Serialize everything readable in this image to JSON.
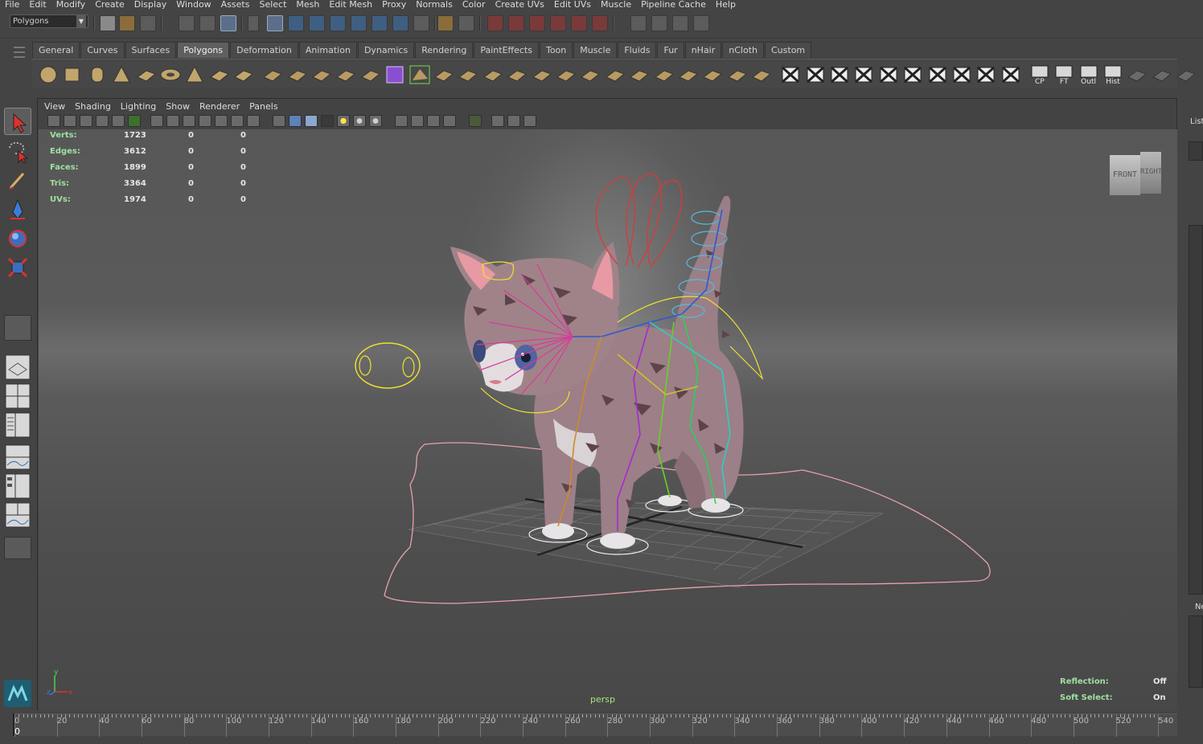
{
  "menubar": [
    "File",
    "Edit",
    "Modify",
    "Create",
    "Display",
    "Window",
    "Assets",
    "Select",
    "Mesh",
    "Edit Mesh",
    "Proxy",
    "Normals",
    "Color",
    "Create UVs",
    "Edit UVs",
    "Muscle",
    "Pipeline Cache",
    "Help"
  ],
  "status_line": {
    "mode": "Polygons"
  },
  "shelf": {
    "tabs": [
      "General",
      "Curves",
      "Surfaces",
      "Polygons",
      "Deformation",
      "Animation",
      "Dynamics",
      "Rendering",
      "PaintEffects",
      "Toon",
      "Muscle",
      "Fluids",
      "Fur",
      "nHair",
      "nCloth",
      "Custom"
    ],
    "active_tab": "Polygons",
    "labeled_icons": [
      "CP",
      "FT",
      "Outl",
      "Hist"
    ]
  },
  "panel": {
    "menu": [
      "View",
      "Shading",
      "Lighting",
      "Show",
      "Renderer",
      "Panels"
    ]
  },
  "hud": {
    "rows": [
      {
        "label": "Verts:",
        "v1": "1723",
        "v2": "0",
        "v3": "0"
      },
      {
        "label": "Edges:",
        "v1": "3612",
        "v2": "0",
        "v3": "0"
      },
      {
        "label": "Faces:",
        "v1": "1899",
        "v2": "0",
        "v3": "0"
      },
      {
        "label": "Tris:",
        "v1": "3364",
        "v2": "0",
        "v3": "0"
      },
      {
        "label": "UVs:",
        "v1": "1974",
        "v2": "0",
        "v3": "0"
      }
    ],
    "camera": "persp",
    "reflection_label": "Reflection:",
    "reflection_value": "Off",
    "soft_select_label": "Soft Select:",
    "soft_select_value": "On"
  },
  "viewcube": {
    "front": "FRONT",
    "right": "RIGHT"
  },
  "axis_labels": {
    "x": "x",
    "y": "y",
    "z": "z"
  },
  "right_side": {
    "top_label": "List",
    "mid_label": "Ne"
  },
  "time_slider": {
    "labels": [
      "0",
      "20",
      "40",
      "60",
      "80",
      "100",
      "120",
      "140",
      "160",
      "180",
      "200",
      "220",
      "240",
      "260",
      "280",
      "300",
      "320",
      "340",
      "360",
      "380",
      "400",
      "420",
      "440",
      "460",
      "480",
      "500",
      "520",
      "540"
    ],
    "current_frame": "0"
  }
}
